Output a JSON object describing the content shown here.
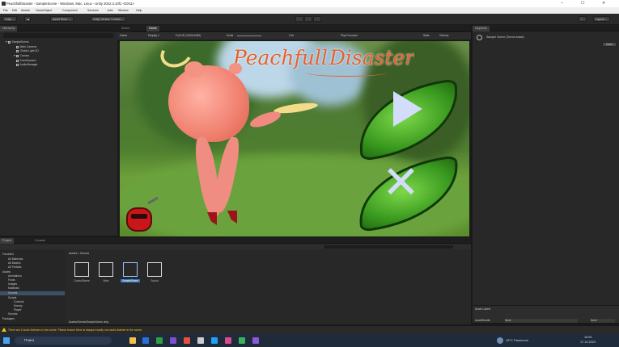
{
  "window": {
    "title": "PeachfullDisaster - SampleScene - Windows, Mac, Linux - Unity 2022.3.10f1 <DX11>"
  },
  "menu": [
    "File",
    "Edit",
    "Assets",
    "GameObject",
    "Component",
    "Services",
    "Jobs",
    "Window",
    "Help"
  ],
  "toolbar": {
    "account": "Unity ⌄",
    "cloud": "Asset Store ⌄",
    "version_control": "Unity Version Control ⌄",
    "layout": "Layout ⌄"
  },
  "hierarchy": {
    "tab": "Hierarchy",
    "items": [
      "SampleScene",
      "Main Camera",
      "Global Light 2D",
      "Canvas",
      "EventSystem",
      "AudioManager"
    ]
  },
  "scene_tabs": [
    "Scene",
    "Game"
  ],
  "game_toolbar": {
    "display": "Game",
    "display2": "Display 1",
    "resolution": "Full HD (1920x1080)",
    "scale_label": "Scale",
    "scale_value": "0.5x",
    "play_mode": "Play Focused",
    "stats": "Stats",
    "gizmos": "Gizmos"
  },
  "game": {
    "title_part1": "Peachfull",
    "title_part2": "Disaster"
  },
  "inspector": {
    "tab": "Inspector",
    "title": "Sample Scene (Scene Asset)",
    "button": "Open"
  },
  "project": {
    "tabs": [
      "Project",
      "Console"
    ],
    "tree": [
      "Favorites",
      "All Materials",
      "All Models",
      "All Prefabs",
      "Assets",
      "Animations",
      "Fonts",
      "Images",
      "Materials",
      "Scenes",
      "Scripts",
      "Controls",
      "Enemy",
      "Player",
      "Sounds",
      "Packages"
    ],
    "breadcrumb": "Assets > Scenes",
    "assets": [
      "ControlScene",
      "Main",
      "SampleScene",
      "Sound"
    ],
    "footer_path": "Assets/Scenes/SampleScene.unity",
    "asset_labels": "Asset Labels",
    "bundle_label": "AssetBundle",
    "bundle_value": "None",
    "bundle_value2": "None"
  },
  "status": {
    "message": "There are 2 audio listeners in the scene. Please ensure there is always exactly one audio listener in the scene."
  },
  "taskbar": {
    "search": "Поиск",
    "weather": "15°C Pasmurno",
    "time": "16:05",
    "date": "17.10.2023"
  },
  "colors": {
    "accent": "#3a79bb",
    "warning": "#f0c419",
    "leaf": "#3a9a1f",
    "peach": "#f08a80",
    "title": "#e4622f"
  }
}
